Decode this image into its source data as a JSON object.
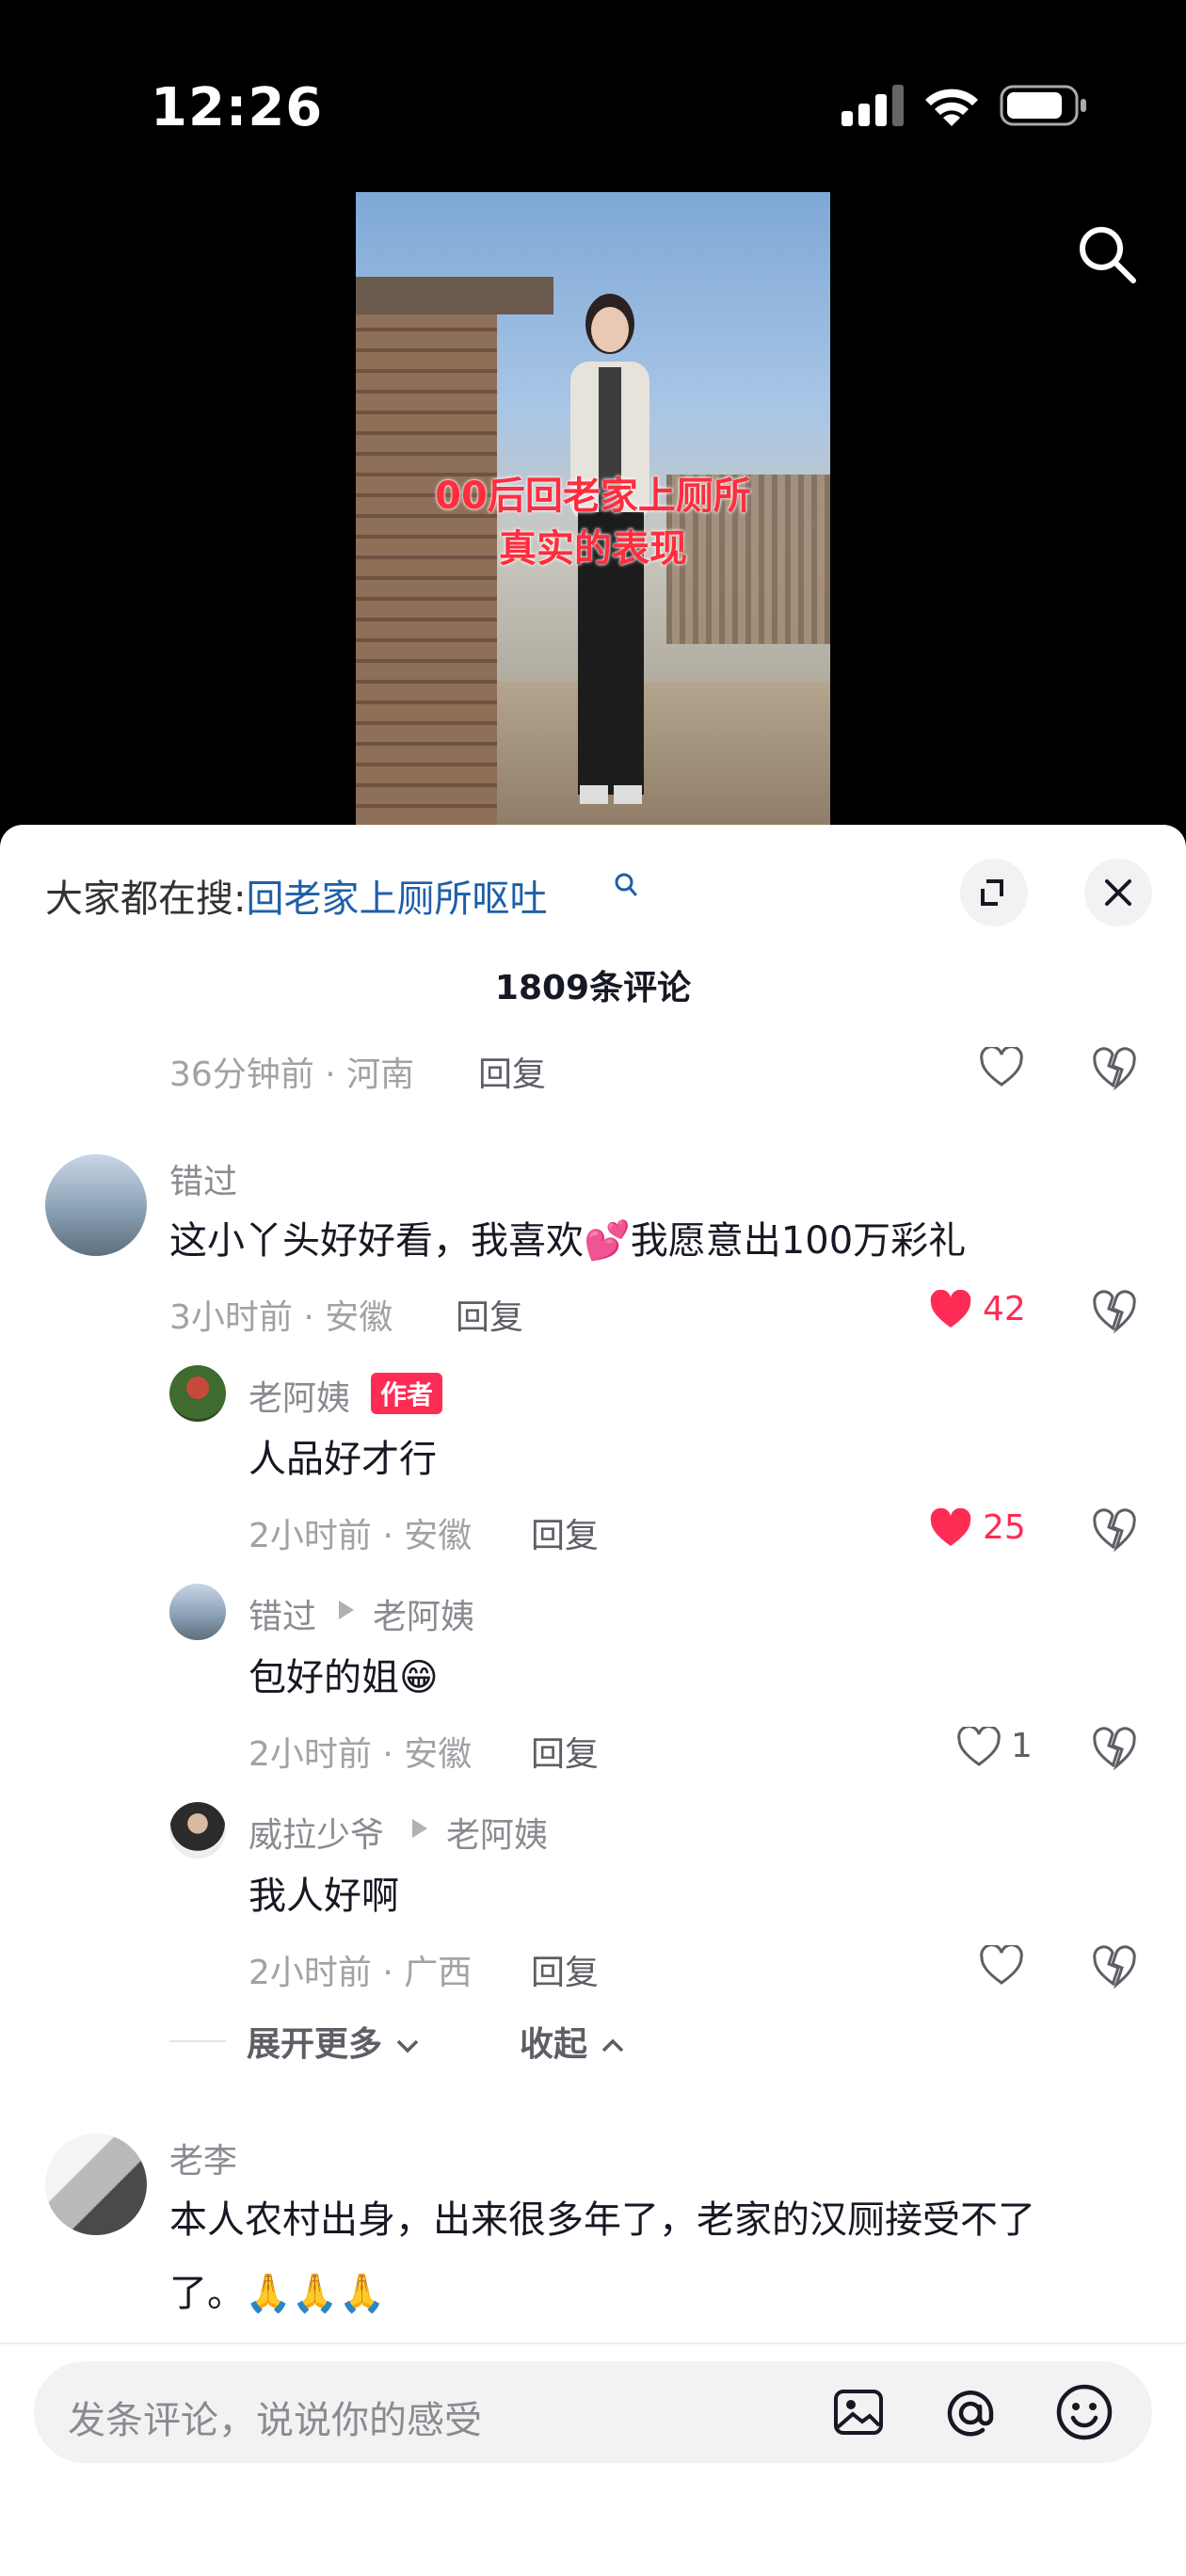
{
  "status_bar": {
    "time": "12:26"
  },
  "video": {
    "overlay_line1": "00后回老家上厕所",
    "overlay_line2": "真实的表现"
  },
  "hot_search": {
    "prefix": "大家都在搜:",
    "query": "回老家上厕所呕吐"
  },
  "comment_count": "1809条评论",
  "reply_label": "回复",
  "prev_meta": "36分钟前 · 河南",
  "comments": [
    {
      "user": "错过",
      "text": "这小丫头好好看，我喜欢💕我愿意出100万彩礼",
      "meta": "3小时前 · 安徽",
      "likes": "42",
      "liked": true
    },
    {
      "user": "老阿姨",
      "badge": "作者",
      "text": "人品好才行",
      "meta": "2小时前 · 安徽",
      "likes": "25",
      "liked": true
    },
    {
      "user": "错过",
      "reply_to": "老阿姨",
      "text": "包好的姐😁",
      "meta": "2小时前 · 安徽",
      "likes": "1",
      "liked": false
    },
    {
      "user": "威拉少爷",
      "reply_to": "老阿姨",
      "text": "我人好啊",
      "meta": "2小时前 · 广西",
      "likes": "",
      "liked": false
    },
    {
      "user": "老李",
      "text_line1": "本人农村出身，出来很多年了，老家的汉厕接受不了",
      "text_line2": "了。🙏🙏🙏"
    }
  ],
  "expand_more": "展开更多",
  "collapse": "收起",
  "input_placeholder": "发条评论，说说你的感受",
  "colors": {
    "like_red": "#fe2c55",
    "link_blue": "#1f5fa8"
  }
}
